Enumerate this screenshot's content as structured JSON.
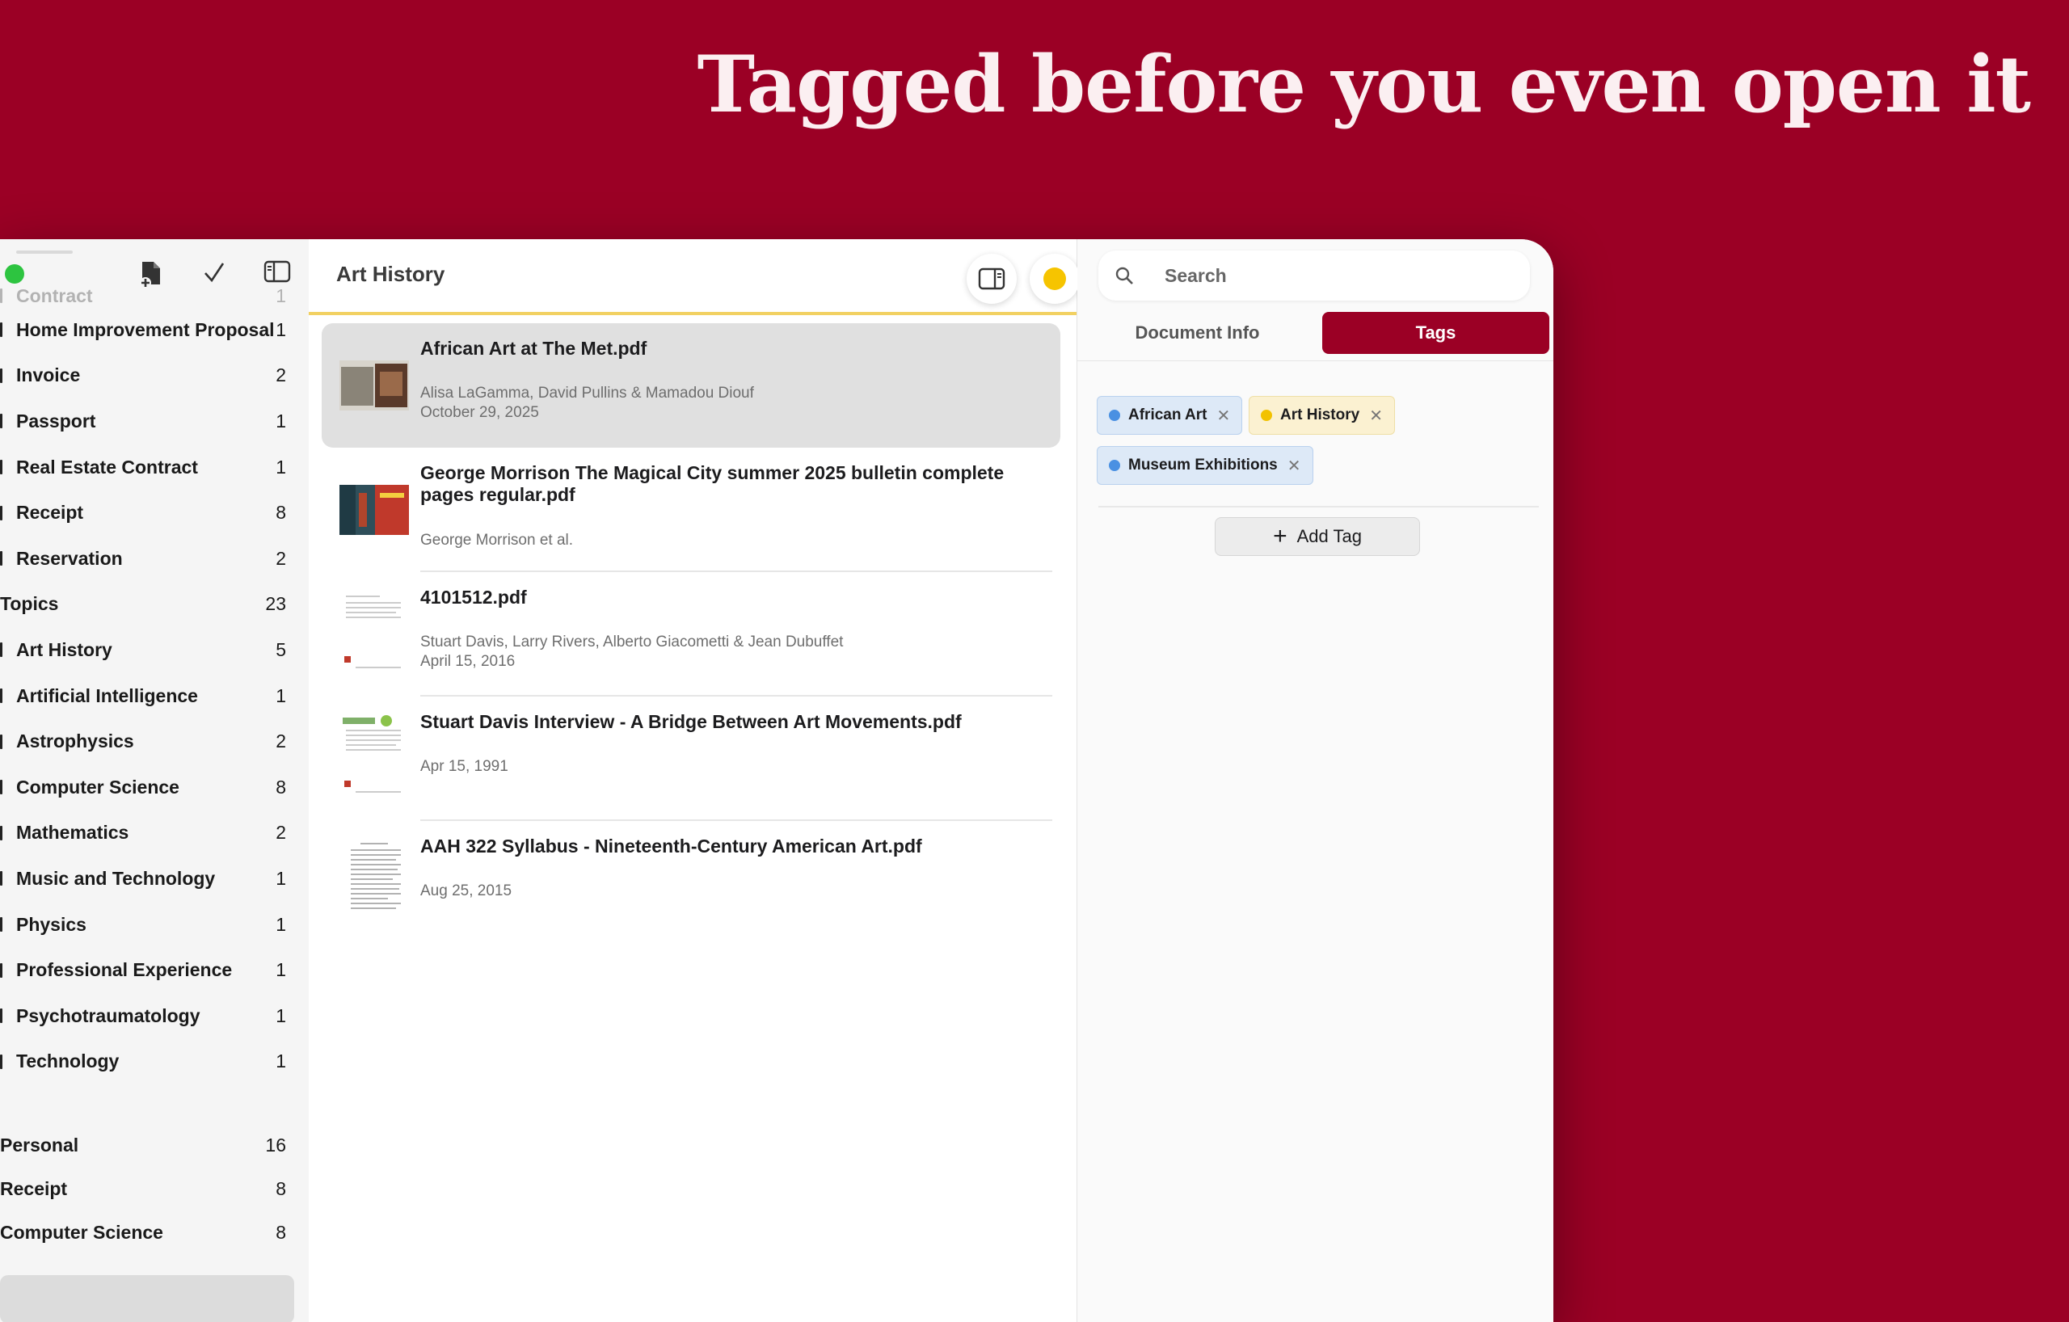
{
  "headline": "Tagged before you even open it",
  "sidebar": {
    "faded_top": {
      "label": "Contract",
      "count": "1"
    },
    "doc_types": [
      {
        "label": "Home Improvement Proposal",
        "count": "1"
      },
      {
        "label": "Invoice",
        "count": "2"
      },
      {
        "label": "Passport",
        "count": "1"
      },
      {
        "label": "Real Estate Contract",
        "count": "1"
      },
      {
        "label": "Receipt",
        "count": "8"
      },
      {
        "label": "Reservation",
        "count": "2"
      }
    ],
    "topics_header": {
      "label": "Topics",
      "count": "23"
    },
    "topics": [
      {
        "label": "Art History",
        "count": "5"
      },
      {
        "label": "Artificial Intelligence",
        "count": "1"
      },
      {
        "label": "Astrophysics",
        "count": "2"
      },
      {
        "label": "Computer Science",
        "count": "8"
      },
      {
        "label": "Mathematics",
        "count": "2"
      },
      {
        "label": "Music and Technology",
        "count": "1"
      },
      {
        "label": "Physics",
        "count": "1"
      },
      {
        "label": "Professional Experience",
        "count": "1"
      },
      {
        "label": "Psychotraumatology",
        "count": "1"
      },
      {
        "label": "Technology",
        "count": "1"
      }
    ],
    "recents": [
      {
        "label": "Personal",
        "count": "16"
      },
      {
        "label": "Receipt",
        "count": "8"
      },
      {
        "label": "Computer Science",
        "count": "8"
      }
    ],
    "icons": {
      "new_doc": "new-document-icon",
      "check": "checkmark-icon",
      "sidebar": "sidebar-toggle-icon"
    }
  },
  "middle": {
    "title": "Art History",
    "documents": [
      {
        "title": "African Art at The Met.pdf",
        "authors": "Alisa LaGamma, David Pullins & Mamadou Diouf",
        "date": "October 29, 2025"
      },
      {
        "title": "George Morrison The Magical City summer 2025 bulletin complete pages regular.pdf",
        "authors": "George Morrison et al.",
        "date": ""
      },
      {
        "title": "4101512.pdf",
        "authors": "Stuart Davis, Larry Rivers, Alberto Giacometti & Jean Dubuffet",
        "date": "April 15, 2016"
      },
      {
        "title": "Stuart Davis Interview - A Bridge Between Art Movements.pdf",
        "authors": "",
        "date": "Apr 15, 1991"
      },
      {
        "title": "AAH 322 Syllabus - Nineteenth-Century American Art.pdf",
        "authors": "",
        "date": "Aug 25, 2015"
      }
    ]
  },
  "right": {
    "search_placeholder": "Search",
    "tabs": {
      "info": "Document Info",
      "tags": "Tags"
    },
    "tags": [
      {
        "label": "African Art",
        "dot": "#4a90e2",
        "bg": "#dde9f7",
        "border": "#b9d1ee"
      },
      {
        "label": "Art History",
        "dot": "#f2c200",
        "bg": "#fbf1d1",
        "border": "#eedfa6"
      },
      {
        "label": "Museum Exhibitions",
        "dot": "#4a90e2",
        "bg": "#dde9f7",
        "border": "#b9d1ee"
      }
    ],
    "add_tag": "Add Tag"
  },
  "colors": {
    "brand": "#9b0025",
    "accent_yellow": "#f6c400"
  }
}
